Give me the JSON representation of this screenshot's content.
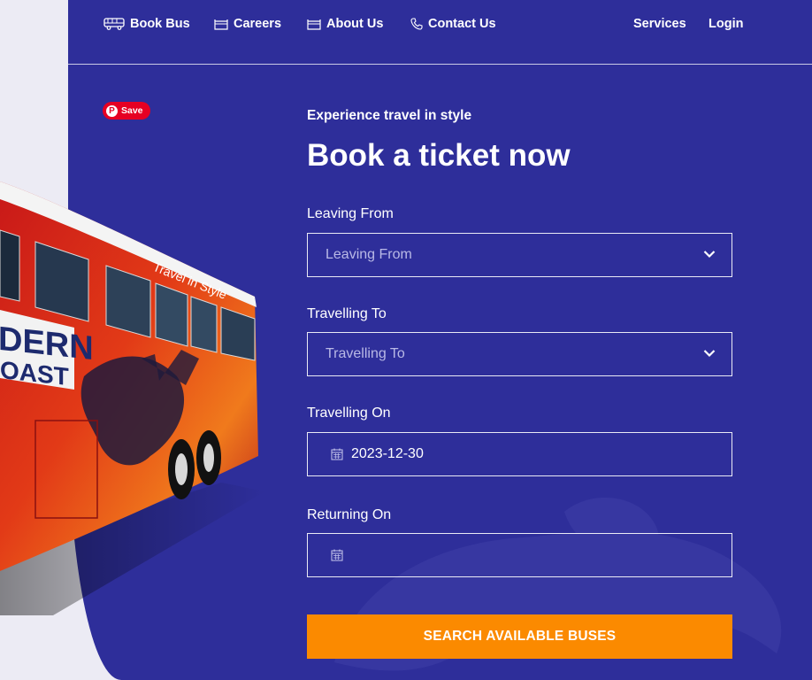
{
  "nav": {
    "left": [
      {
        "label": "Book Bus",
        "icon": "bus-icon"
      },
      {
        "label": "Careers",
        "icon": "briefcase-icon"
      },
      {
        "label": "About Us",
        "icon": "briefcase-icon"
      },
      {
        "label": "Contact Us",
        "icon": "phone-icon"
      }
    ],
    "right": [
      {
        "label": "Services"
      },
      {
        "label": "Login"
      }
    ]
  },
  "pinterest": {
    "save_label": "Save",
    "logo": "P"
  },
  "hero": {
    "subtitle": "Experience travel in style",
    "title": "Book a ticket now",
    "bus_livery": {
      "line1": "DERN",
      "line2": "OAST",
      "slogan": "Travel in Style"
    }
  },
  "form": {
    "leaving_from": {
      "label": "Leaving From",
      "placeholder": "Leaving From",
      "icon": "chevron-down-icon"
    },
    "travelling_to": {
      "label": "Travelling To",
      "placeholder": "Travelling To",
      "icon": "chevron-down-icon"
    },
    "travelling_on": {
      "label": "Travelling On",
      "value": "2023-12-30",
      "icon": "calendar-icon"
    },
    "returning_on": {
      "label": "Returning On",
      "value": "",
      "icon": "calendar-icon"
    },
    "submit_label": "SEARCH AVAILABLE BUSES"
  },
  "colors": {
    "panel": "#2e2e9a",
    "page_bg": "#ecebf4",
    "button": "#fb8a00",
    "pinterest": "#e60023"
  }
}
